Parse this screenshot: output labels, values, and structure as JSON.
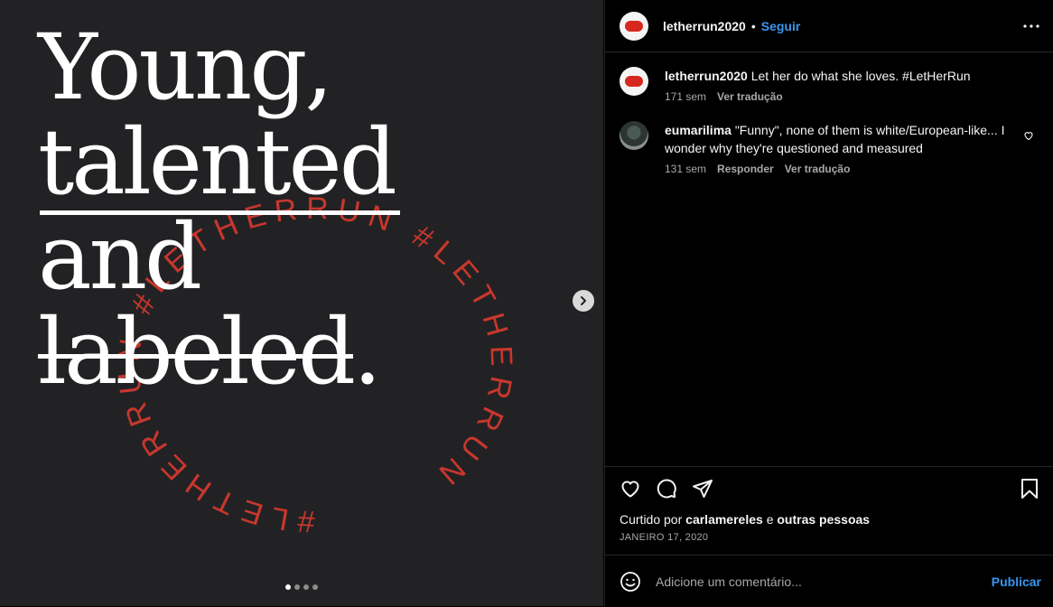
{
  "media": {
    "headline": {
      "line1": "Young,",
      "line2": "talented",
      "line3": "and",
      "line4": "labeled",
      "line4_end": "."
    },
    "ring_text": "#LETHERRUN #LETHERRUN #LETHERRUN",
    "ring_color": "#c8372d",
    "carousel_dots": 4,
    "carousel_active": 1
  },
  "header": {
    "username": "letherrun2020",
    "separator": "•",
    "follow_label": "Seguir",
    "more_label": "•••"
  },
  "comments": [
    {
      "username": "letherrun2020",
      "text": "Let her do what she loves. #LetHerRun",
      "time": "171 sem",
      "translate": "Ver tradução"
    },
    {
      "username": "eumarilima",
      "text": "\"Funny\", none of them is white/European-like... I wonder why they're questioned and measured",
      "time": "131 sem",
      "reply": "Responder",
      "translate": "Ver tradução"
    }
  ],
  "likes": {
    "prefix": "Curtido por",
    "user": "carlamereles",
    "conj": "e",
    "others": "outras pessoas"
  },
  "date": "JANEIRO 17, 2020",
  "add_comment": {
    "placeholder": "Adicione um comentário...",
    "publish_label": "Publicar"
  },
  "colors": {
    "accent": "#3897f0",
    "brand_red": "#d6281e"
  }
}
